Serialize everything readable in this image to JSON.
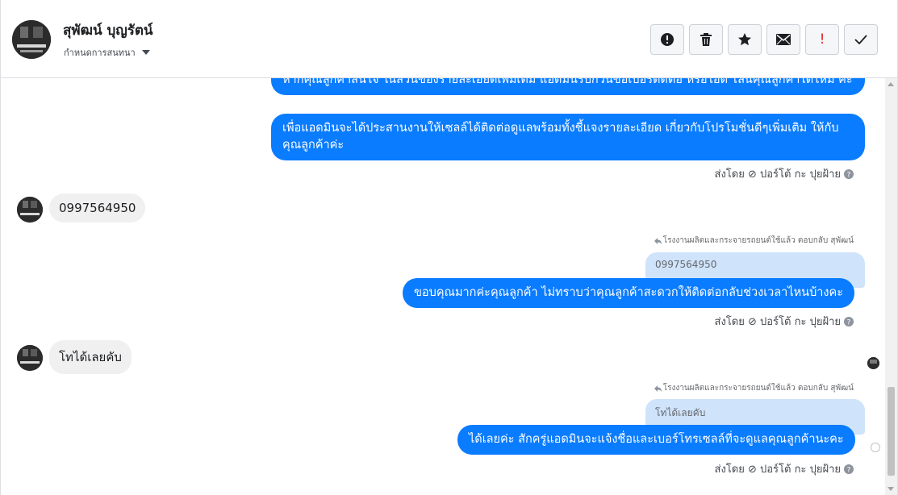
{
  "header": {
    "contact_name": "สุพัฒน์ บุญรัตน์",
    "assign_label": "กำหนดการสนทนา",
    "toolbar": {
      "icons": [
        "alert-icon",
        "trash-icon",
        "star-icon",
        "envelope-icon",
        "important-icon",
        "check-icon"
      ],
      "important_glyph": "!"
    }
  },
  "thread": {
    "messages": [
      {
        "text": "หากคุณลูกค้าสนใจ ในส่วนของรายละเอียดเพิ่มเติม แอดมินรบกวนขอเบอร์ติดต่อ หรือไอดี ไลน์คุณลูกค้าได้ไหม คะ"
      },
      {
        "text": "เพื่อแอดมินจะได้ประสานงานให้เซลล์ได้ติดต่อดูแลพร้อมทั้งชี้แจงรายละเอียด เกี่ยวกับโปรโมชั่นดีๆเพิ่มเติม ให้กับคุณลูกค้าค่ะ"
      },
      {
        "sent_by": "ส่งโดย ⊘ ปอร์โต้ กะ ปุยฝ้าย"
      },
      {
        "text": "0997564950"
      },
      {
        "reply_note": "โรงงานผลิตและกระจายรถยนต์ใช้แล้ว ตอบกลับ สุพัฒน์"
      },
      {
        "quote": "0997564950"
      },
      {
        "text": "ขอบคุณมากค่ะคุณลูกค้า ไม่ทราบว่าคุณลูกค้าสะดวกให้ติดต่อกลับช่วงเวลาไหนบ้างคะ"
      },
      {
        "sent_by": "ส่งโดย ⊘ ปอร์โต้ กะ ปุยฝ้าย"
      },
      {
        "text": "โทได้เลยคับ"
      },
      {
        "reply_note": "โรงงานผลิตและกระจายรถยนต์ใช้แล้ว ตอบกลับ สุพัฒน์"
      },
      {
        "quote": "โทได้เลยคับ"
      },
      {
        "text": "ได้เลยค่ะ สักครู่แอดมินจะแจ้งชื่อและเบอร์โทรเซลล์ที่จะดูแลคุณลูกค้านะคะ"
      },
      {
        "sent_by": "ส่งโดย ⊘ ปอร์โต้ กะ ปุยฝ้าย"
      }
    ]
  },
  "colors": {
    "outgoing_bubble": "#0a7cff",
    "incoming_bubble": "#f0f0f0",
    "quote_bubble": "#cfe3fb"
  }
}
